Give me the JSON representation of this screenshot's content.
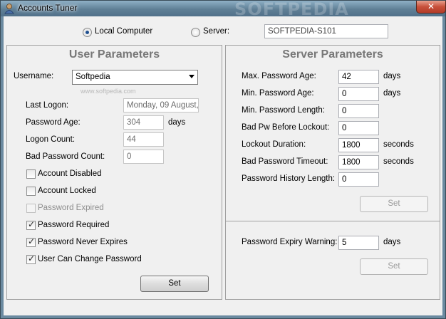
{
  "window": {
    "title": "Accounts Tuner",
    "close_glyph": "✕",
    "watermark": "SOFTPEDIA"
  },
  "mode": {
    "local_label": "Local Computer",
    "server_label": "Server:",
    "server_value": "SOFTPEDIA-S101",
    "selected": "local"
  },
  "user": {
    "title": "User Parameters",
    "username_label": "Username:",
    "username_value": "Softpedia",
    "combo_watermark": "www.softpedia.com",
    "last_logon_label": "Last Logon:",
    "last_logon_value": "Monday, 09 August,",
    "password_age_label": "Password Age:",
    "password_age_value": "304",
    "password_age_unit": "days",
    "logon_count_label": "Logon Count:",
    "logon_count_value": "44",
    "bad_password_count_label": "Bad Password Count:",
    "bad_password_count_value": "0",
    "checkboxes": [
      {
        "label": "Account Disabled",
        "checked": false,
        "enabled": true
      },
      {
        "label": "Account Locked",
        "checked": false,
        "enabled": true
      },
      {
        "label": "Password Expired",
        "checked": false,
        "enabled": false
      },
      {
        "label": "Password Required",
        "checked": true,
        "enabled": true
      },
      {
        "label": "Password Never Expires",
        "checked": true,
        "enabled": true
      },
      {
        "label": "User Can Change Password",
        "checked": true,
        "enabled": true
      }
    ],
    "set_label": "Set"
  },
  "server": {
    "title": "Server Parameters",
    "fields": [
      {
        "label": "Max. Password Age:",
        "value": "42",
        "unit": "days"
      },
      {
        "label": "Min. Password Age:",
        "value": "0",
        "unit": "days"
      },
      {
        "label": "Min. Password Length:",
        "value": "0",
        "unit": ""
      },
      {
        "label": "Bad Pw Before Lockout:",
        "value": "0",
        "unit": ""
      },
      {
        "label": "Lockout Duration:",
        "value": "1800",
        "unit": "seconds"
      },
      {
        "label": "Bad Password Timeout:",
        "value": "1800",
        "unit": "seconds"
      },
      {
        "label": "Password History Length:",
        "value": "0",
        "unit": ""
      }
    ],
    "set_label": "Set",
    "expiry_warning_label": "Password Expiry Warning:",
    "expiry_warning_value": "5",
    "expiry_warning_unit": "days",
    "set2_label": "Set"
  }
}
